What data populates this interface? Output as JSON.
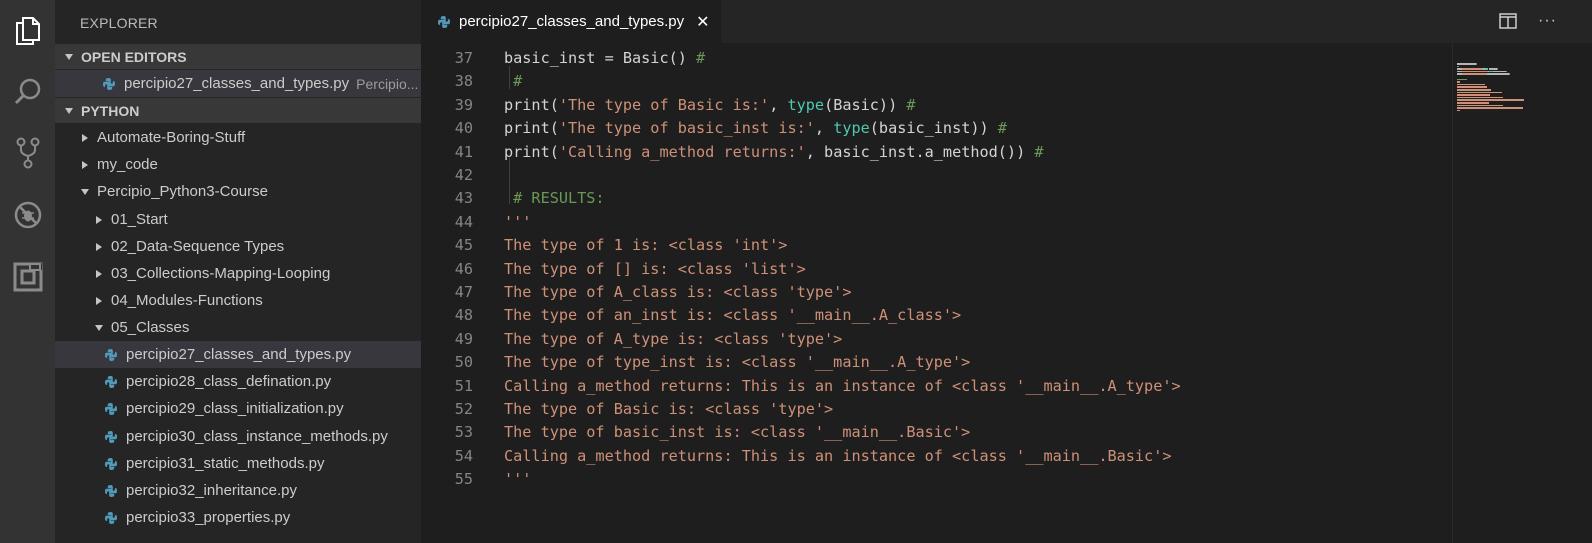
{
  "activity_bar": {
    "items": [
      {
        "icon": "files-icon"
      },
      {
        "icon": "search-icon"
      },
      {
        "icon": "source-control-icon"
      },
      {
        "icon": "debug-icon"
      },
      {
        "icon": "extensions-icon"
      }
    ]
  },
  "sidebar": {
    "title": "EXPLORER",
    "open_editors": {
      "label": "OPEN EDITORS",
      "items": [
        {
          "name": "percipio27_classes_and_types.py",
          "description": "Percipio..."
        }
      ]
    },
    "workspace": {
      "label": "PYTHON",
      "items": [
        {
          "label": "Automate-Boring-Stuff",
          "type": "folder",
          "expanded": false
        },
        {
          "label": "my_code",
          "type": "folder",
          "expanded": false
        },
        {
          "label": "Percipio_Python3-Course",
          "type": "folder",
          "expanded": true
        },
        {
          "label": "01_Start",
          "type": "folder",
          "expanded": false
        },
        {
          "label": "02_Data-Sequence Types",
          "type": "folder",
          "expanded": false
        },
        {
          "label": "03_Collections-Mapping-Looping",
          "type": "folder",
          "expanded": false
        },
        {
          "label": "04_Modules-Functions",
          "type": "folder",
          "expanded": false
        },
        {
          "label": "05_Classes",
          "type": "folder",
          "expanded": true
        },
        {
          "label": "percipio27_classes_and_types.py",
          "type": "file",
          "selected": true
        },
        {
          "label": "percipio28_class_defination.py",
          "type": "file"
        },
        {
          "label": "percipio29_class_initialization.py",
          "type": "file"
        },
        {
          "label": "percipio30_class_instance_methods.py",
          "type": "file"
        },
        {
          "label": "percipio31_static_methods.py",
          "type": "file"
        },
        {
          "label": "percipio32_inheritance.py",
          "type": "file"
        },
        {
          "label": "percipio33_properties.py",
          "type": "file"
        }
      ]
    }
  },
  "tab": {
    "label": "percipio27_classes_and_types.py",
    "close": "✕"
  },
  "editor_actions": {
    "split": "split-editor-icon",
    "more": "···"
  },
  "editor": {
    "lines": [
      {
        "num": "37",
        "tokens": [
          {
            "t": "basic_inst = Basic() ",
            "c": "pl"
          },
          {
            "t": "#",
            "c": "cm"
          }
        ]
      },
      {
        "num": "38",
        "tokens": [
          {
            "t": " #",
            "c": "cm"
          }
        ]
      },
      {
        "num": "39",
        "tokens": [
          {
            "t": "print(",
            "c": "pl"
          },
          {
            "t": "'The type of Basic is:'",
            "c": "str"
          },
          {
            "t": ", ",
            "c": "pl"
          },
          {
            "t": "type",
            "c": "fn"
          },
          {
            "t": "(Basic)) ",
            "c": "pl"
          },
          {
            "t": "#",
            "c": "cm"
          }
        ]
      },
      {
        "num": "40",
        "tokens": [
          {
            "t": "print(",
            "c": "pl"
          },
          {
            "t": "'The type of basic_inst is:'",
            "c": "str"
          },
          {
            "t": ", ",
            "c": "pl"
          },
          {
            "t": "type",
            "c": "fn"
          },
          {
            "t": "(basic_inst)) ",
            "c": "pl"
          },
          {
            "t": "#",
            "c": "cm"
          }
        ]
      },
      {
        "num": "41",
        "tokens": [
          {
            "t": "print(",
            "c": "pl"
          },
          {
            "t": "'Calling a_method returns:'",
            "c": "str"
          },
          {
            "t": ", basic_inst.a_method()) ",
            "c": "pl"
          },
          {
            "t": "#",
            "c": "cm"
          }
        ]
      },
      {
        "num": "42",
        "tokens": []
      },
      {
        "num": "43",
        "tokens": [
          {
            "t": " # RESULTS:",
            "c": "cm"
          }
        ]
      },
      {
        "num": "44",
        "tokens": [
          {
            "t": "'''",
            "c": "str"
          }
        ]
      },
      {
        "num": "45",
        "tokens": [
          {
            "t": "The type of 1 is: <class 'int'>",
            "c": "str"
          }
        ]
      },
      {
        "num": "46",
        "tokens": [
          {
            "t": "The type of [] is: <class 'list'>",
            "c": "str"
          }
        ]
      },
      {
        "num": "47",
        "tokens": [
          {
            "t": "The type of A_class is: <class 'type'>",
            "c": "str"
          }
        ]
      },
      {
        "num": "48",
        "tokens": [
          {
            "t": "The type of an_inst is: <class '__main__.A_class'>",
            "c": "str"
          }
        ]
      },
      {
        "num": "49",
        "tokens": [
          {
            "t": "The type of A_type is: <class 'type'>",
            "c": "str"
          }
        ]
      },
      {
        "num": "50",
        "tokens": [
          {
            "t": "The type of type_inst is: <class '__main__.A_type'>",
            "c": "str"
          }
        ]
      },
      {
        "num": "51",
        "tokens": [
          {
            "t": "Calling a_method returns: This is an instance of <class '__main__.A_type'>",
            "c": "str"
          }
        ]
      },
      {
        "num": "52",
        "tokens": [
          {
            "t": "The type of Basic is: <class 'type'>",
            "c": "str"
          }
        ]
      },
      {
        "num": "53",
        "tokens": [
          {
            "t": "The type of basic_inst is: <class '__main__.Basic'>",
            "c": "str"
          }
        ]
      },
      {
        "num": "54",
        "tokens": [
          {
            "t": "Calling a_method returns: This is an instance of <class '__main__.Basic'>",
            "c": "str"
          }
        ]
      },
      {
        "num": "55",
        "tokens": [
          {
            "t": "'''",
            "c": "str"
          }
        ]
      }
    ]
  },
  "colors": {
    "string": "#ce9178",
    "function": "#4ec9b0",
    "comment": "#6a9955",
    "plain": "#d4d4d4",
    "line_number": "#858585",
    "python_icon": "#519aba"
  }
}
